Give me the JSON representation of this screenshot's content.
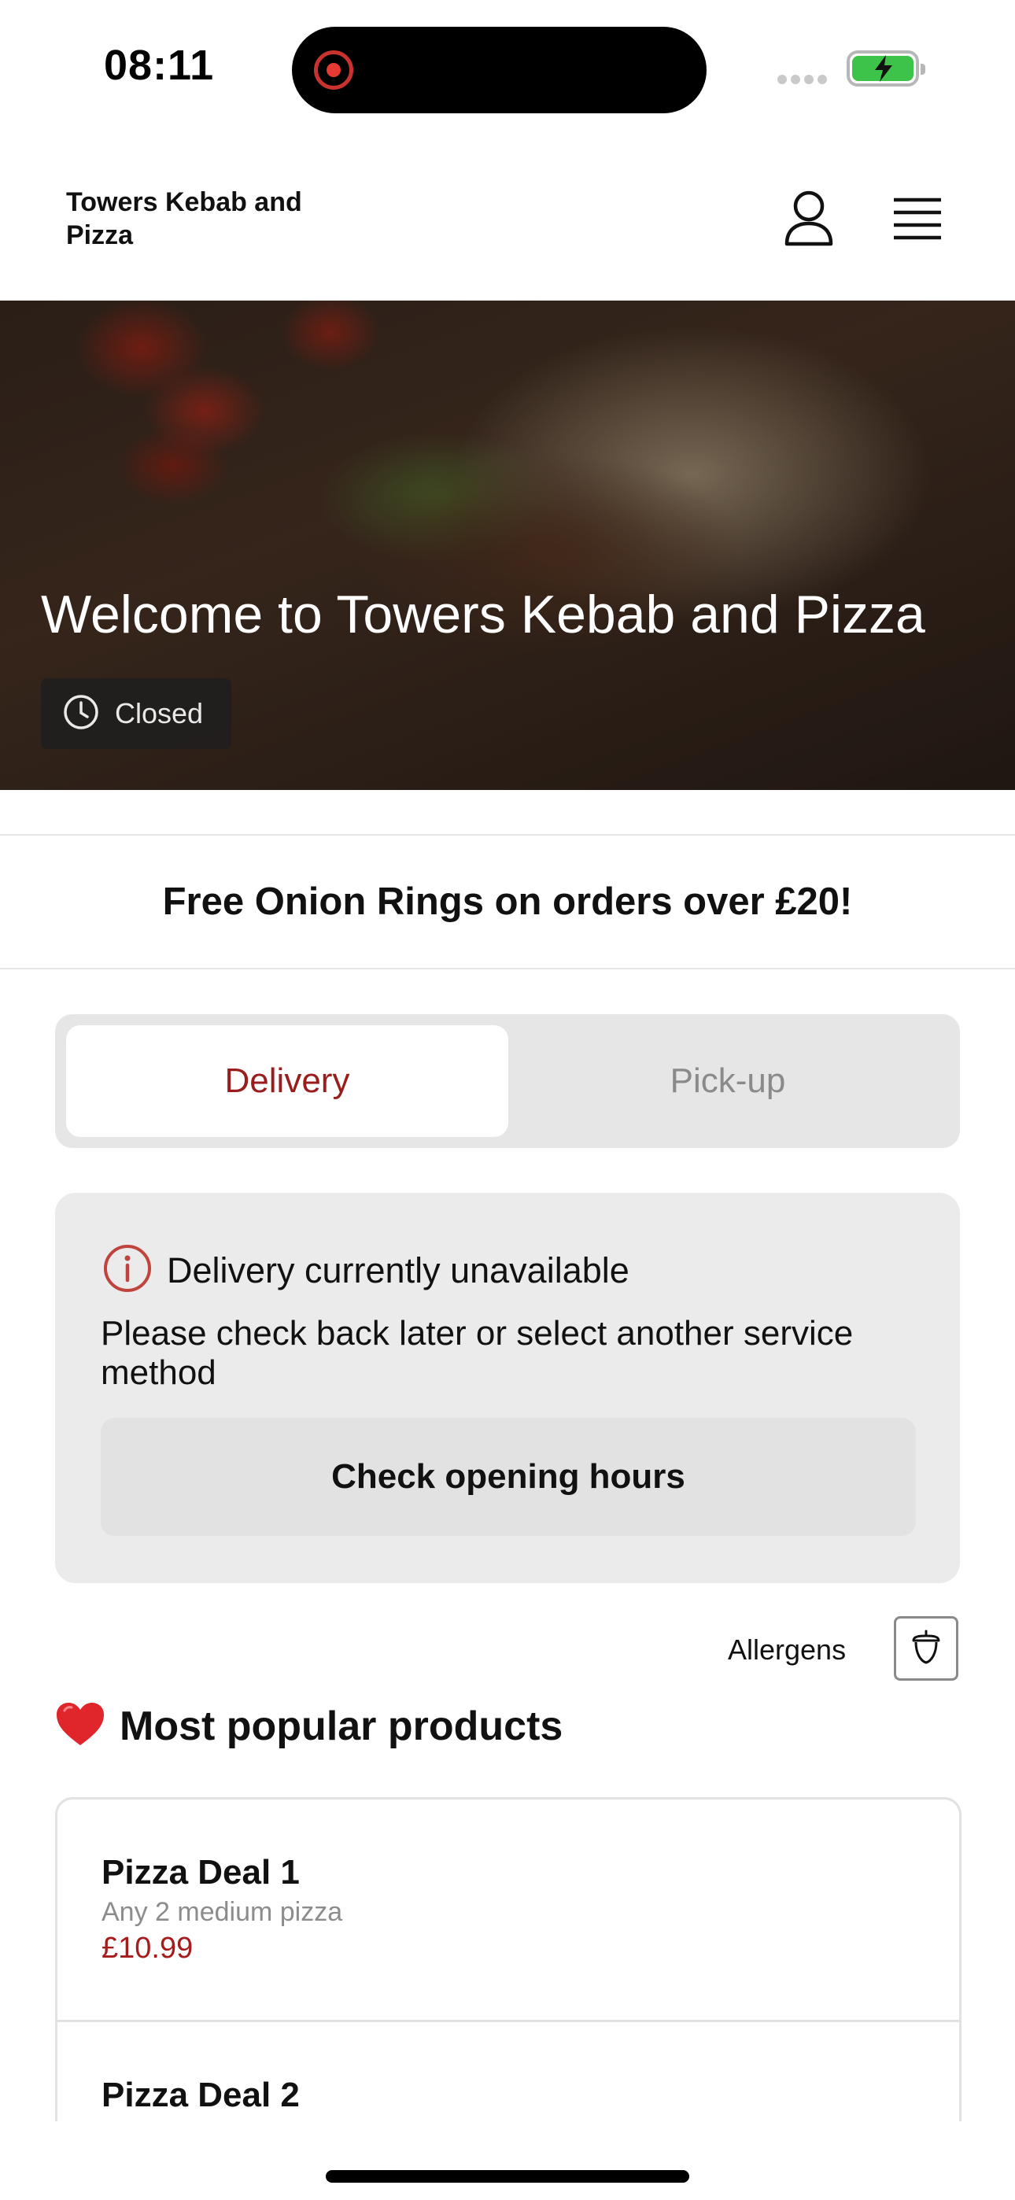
{
  "status_bar": {
    "time": "08:11"
  },
  "header": {
    "brand": "Towers Kebab and Pizza",
    "icons": [
      "user-icon",
      "menu-icon"
    ]
  },
  "hero": {
    "title": "Welcome to Towers Kebab and Pizza",
    "status_badge": "Closed"
  },
  "promo": {
    "text": "Free Onion Rings on orders over £20!"
  },
  "service_toggle": {
    "options": [
      "Delivery",
      "Pick-up"
    ],
    "selected": "Delivery"
  },
  "notice": {
    "title": "Delivery currently unavailable",
    "body": "Please check back later or select another service method",
    "button": "Check opening hours"
  },
  "allergens": {
    "label": "Allergens"
  },
  "popular": {
    "heading": "Most popular products",
    "products": [
      {
        "name": "Pizza Deal 1",
        "description": "Any 2 medium pizza",
        "price": "£10.99"
      },
      {
        "name": "Pizza Deal 2",
        "description": "",
        "price": ""
      }
    ]
  },
  "colors": {
    "accent": "#9a1d1d",
    "price": "#a51c1c",
    "segment_bg": "#e6e6e6",
    "card_bg": "#ebebeb"
  }
}
